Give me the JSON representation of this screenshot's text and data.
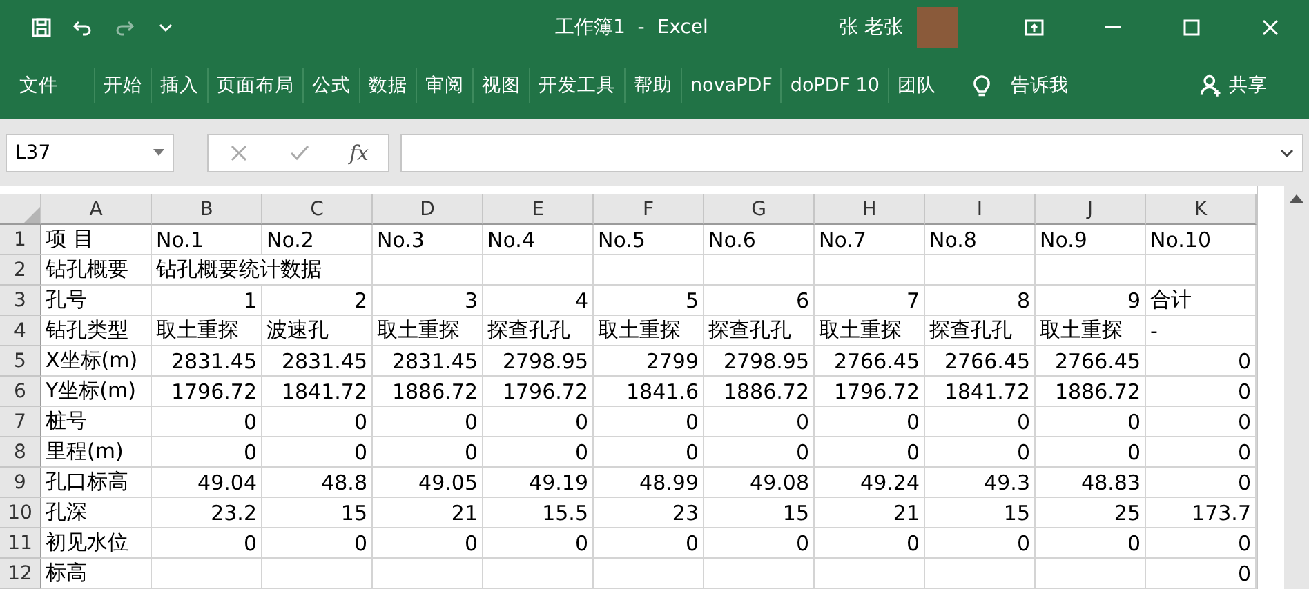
{
  "window": {
    "title": "工作簿1  -  Excel",
    "user": "张 老张"
  },
  "ribbon": {
    "tabs": [
      "文件",
      "开始",
      "插入",
      "页面布局",
      "公式",
      "数据",
      "审阅",
      "视图",
      "开发工具",
      "帮助",
      "novaPDF",
      "doPDF 10",
      "团队"
    ],
    "tell_me": "告诉我",
    "share": "共享"
  },
  "formula_bar": {
    "name_box": "L37",
    "fx": "fx"
  },
  "sheet": {
    "columns": [
      "A",
      "B",
      "C",
      "D",
      "E",
      "F",
      "G",
      "H",
      "I",
      "J",
      "K"
    ],
    "rows": [
      {
        "number": "1",
        "cells": [
          {
            "text": "项  目",
            "kind": "text"
          },
          {
            "text": "No.1",
            "kind": "text"
          },
          {
            "text": "No.2",
            "kind": "text"
          },
          {
            "text": "No.3",
            "kind": "text"
          },
          {
            "text": "No.4",
            "kind": "text"
          },
          {
            "text": "No.5",
            "kind": "text"
          },
          {
            "text": "No.6",
            "kind": "text"
          },
          {
            "text": "No.7",
            "kind": "text"
          },
          {
            "text": "No.8",
            "kind": "text"
          },
          {
            "text": "No.9",
            "kind": "text"
          },
          {
            "text": "No.10",
            "kind": "text"
          }
        ]
      },
      {
        "number": "2",
        "cells": [
          {
            "text": "钻孔概要",
            "kind": "text"
          },
          {
            "text": "钻孔概要统计数据",
            "kind": "heading"
          },
          null,
          null,
          null,
          null,
          null,
          null,
          null,
          null
        ]
      },
      {
        "number": "3",
        "cells": [
          {
            "text": "孔号",
            "kind": "text"
          },
          {
            "text": "1",
            "kind": "num"
          },
          {
            "text": "2",
            "kind": "num"
          },
          {
            "text": "3",
            "kind": "num"
          },
          {
            "text": "4",
            "kind": "num"
          },
          {
            "text": "5",
            "kind": "num"
          },
          {
            "text": "6",
            "kind": "num"
          },
          {
            "text": "7",
            "kind": "num"
          },
          {
            "text": "8",
            "kind": "num"
          },
          {
            "text": "9",
            "kind": "num"
          },
          {
            "text": "合计",
            "kind": "text"
          }
        ]
      },
      {
        "number": "4",
        "cells": [
          {
            "text": "钻孔类型",
            "kind": "text"
          },
          {
            "text": "取土重探",
            "kind": "text"
          },
          {
            "text": "波速孔",
            "kind": "text"
          },
          {
            "text": "取土重探",
            "kind": "text"
          },
          {
            "text": "探查孔孔",
            "kind": "text"
          },
          {
            "text": "取土重探",
            "kind": "text"
          },
          {
            "text": "探查孔孔",
            "kind": "text"
          },
          {
            "text": "取土重探",
            "kind": "text"
          },
          {
            "text": "探查孔孔",
            "kind": "text"
          },
          {
            "text": "取土重探",
            "kind": "text"
          },
          {
            "text": "-",
            "kind": "text"
          }
        ]
      },
      {
        "number": "5",
        "cells": [
          {
            "text": "X坐标(m)",
            "kind": "text"
          },
          {
            "text": "2831.45",
            "kind": "num"
          },
          {
            "text": "2831.45",
            "kind": "num"
          },
          {
            "text": "2831.45",
            "kind": "num"
          },
          {
            "text": "2798.95",
            "kind": "num"
          },
          {
            "text": "2799",
            "kind": "num"
          },
          {
            "text": "2798.95",
            "kind": "num"
          },
          {
            "text": "2766.45",
            "kind": "num"
          },
          {
            "text": "2766.45",
            "kind": "num"
          },
          {
            "text": "2766.45",
            "kind": "num"
          },
          {
            "text": "0",
            "kind": "num"
          }
        ]
      },
      {
        "number": "6",
        "cells": [
          {
            "text": "Y坐标(m)",
            "kind": "text"
          },
          {
            "text": "1796.72",
            "kind": "num"
          },
          {
            "text": "1841.72",
            "kind": "num"
          },
          {
            "text": "1886.72",
            "kind": "num"
          },
          {
            "text": "1796.72",
            "kind": "num"
          },
          {
            "text": "1841.6",
            "kind": "num"
          },
          {
            "text": "1886.72",
            "kind": "num"
          },
          {
            "text": "1796.72",
            "kind": "num"
          },
          {
            "text": "1841.72",
            "kind": "num"
          },
          {
            "text": "1886.72",
            "kind": "num"
          },
          {
            "text": "0",
            "kind": "num"
          }
        ]
      },
      {
        "number": "7",
        "cells": [
          {
            "text": "桩号",
            "kind": "text"
          },
          {
            "text": "0",
            "kind": "num"
          },
          {
            "text": "0",
            "kind": "num"
          },
          {
            "text": "0",
            "kind": "num"
          },
          {
            "text": "0",
            "kind": "num"
          },
          {
            "text": "0",
            "kind": "num"
          },
          {
            "text": "0",
            "kind": "num"
          },
          {
            "text": "0",
            "kind": "num"
          },
          {
            "text": "0",
            "kind": "num"
          },
          {
            "text": "0",
            "kind": "num"
          },
          {
            "text": "0",
            "kind": "num"
          }
        ]
      },
      {
        "number": "8",
        "cells": [
          {
            "text": "里程(m)",
            "kind": "text"
          },
          {
            "text": "0",
            "kind": "num"
          },
          {
            "text": "0",
            "kind": "num"
          },
          {
            "text": "0",
            "kind": "num"
          },
          {
            "text": "0",
            "kind": "num"
          },
          {
            "text": "0",
            "kind": "num"
          },
          {
            "text": "0",
            "kind": "num"
          },
          {
            "text": "0",
            "kind": "num"
          },
          {
            "text": "0",
            "kind": "num"
          },
          {
            "text": "0",
            "kind": "num"
          },
          {
            "text": "0",
            "kind": "num"
          }
        ]
      },
      {
        "number": "9",
        "cells": [
          {
            "text": "孔口标高",
            "kind": "text"
          },
          {
            "text": "49.04",
            "kind": "num"
          },
          {
            "text": "48.8",
            "kind": "num"
          },
          {
            "text": "49.05",
            "kind": "num"
          },
          {
            "text": "49.19",
            "kind": "num"
          },
          {
            "text": "48.99",
            "kind": "num"
          },
          {
            "text": "49.08",
            "kind": "num"
          },
          {
            "text": "49.24",
            "kind": "num"
          },
          {
            "text": "49.3",
            "kind": "num"
          },
          {
            "text": "48.83",
            "kind": "num"
          },
          {
            "text": "0",
            "kind": "num"
          }
        ]
      },
      {
        "number": "10",
        "cells": [
          {
            "text": "孔深",
            "kind": "text"
          },
          {
            "text": "23.2",
            "kind": "num"
          },
          {
            "text": "15",
            "kind": "num"
          },
          {
            "text": "21",
            "kind": "num"
          },
          {
            "text": "15.5",
            "kind": "num"
          },
          {
            "text": "23",
            "kind": "num"
          },
          {
            "text": "15",
            "kind": "num"
          },
          {
            "text": "21",
            "kind": "num"
          },
          {
            "text": "15",
            "kind": "num"
          },
          {
            "text": "25",
            "kind": "num"
          },
          {
            "text": "173.7",
            "kind": "num"
          }
        ]
      },
      {
        "number": "11",
        "cells": [
          {
            "text": "初见水位",
            "kind": "text"
          },
          {
            "text": "0",
            "kind": "num"
          },
          {
            "text": "0",
            "kind": "num"
          },
          {
            "text": "0",
            "kind": "num"
          },
          {
            "text": "0",
            "kind": "num"
          },
          {
            "text": "0",
            "kind": "num"
          },
          {
            "text": "0",
            "kind": "num"
          },
          {
            "text": "0",
            "kind": "num"
          },
          {
            "text": "0",
            "kind": "num"
          },
          {
            "text": "0",
            "kind": "num"
          },
          {
            "text": "0",
            "kind": "num"
          }
        ]
      },
      {
        "number": "12",
        "cells": [
          {
            "text": "标高",
            "kind": "text"
          },
          null,
          null,
          null,
          null,
          null,
          null,
          null,
          null,
          null,
          {
            "text": "0",
            "kind": "num"
          }
        ]
      }
    ]
  }
}
